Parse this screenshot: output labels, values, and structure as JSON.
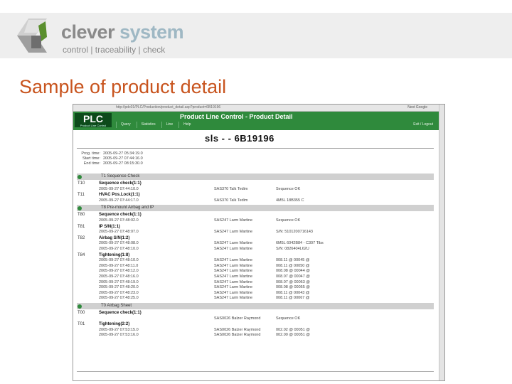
{
  "brand": {
    "name_a": "clever",
    "name_b": "system",
    "tagline": "control | traceability | check"
  },
  "slide_title": "Sample of product detail",
  "browser": {
    "url": "http://pdc01/PLC/Production/product_detail.asp?product=6B19196",
    "toolbar_right": "Next  Google"
  },
  "app": {
    "logo": "PLC",
    "logo_sub": "Product Line Control",
    "title": "Product Line Control - Product Detail",
    "nav": [
      "Query",
      "Statistics",
      "Line",
      "Help"
    ],
    "nav_right": "Exit / Logout",
    "heading": "sls -  - 6B19196"
  },
  "times": [
    {
      "label": "Prog. time:",
      "value": "2005-09-27 05:34:19.0"
    },
    {
      "label": "Start time:",
      "value": "2005-09-27 07:44:16.0"
    },
    {
      "label": "End time:",
      "value": "2005-09-27 08:15:30.0"
    }
  ],
  "sections": [
    {
      "title": "T1 Sequence Check",
      "tests": [
        {
          "code": "T10",
          "name": "Sequence check(1:1)",
          "rows": [
            {
              "date": "2005-09-27 07:44:10.0",
              "who": "SAS370 Talk Tedim",
              "result": "Sequence OK"
            }
          ]
        },
        {
          "code": "T11",
          "name": "HVAC Pos.Lock(1:1)",
          "rows": [
            {
              "date": "2005-09-27 07:44:17.0",
              "who": "SAS370 Talk Tedim",
              "result": "4M5L 18B355 C"
            }
          ]
        }
      ]
    },
    {
      "title": "T8 Pre-mount Airbag and IP",
      "tests": [
        {
          "code": "T80",
          "name": "Sequence check(1:1)",
          "rows": [
            {
              "date": "2005-09-27 07:48:02.0",
              "who": "SAS247 Larm Martine",
              "result": "Sequence OK"
            }
          ]
        },
        {
          "code": "T81",
          "name": "IP S/N(1:1)",
          "rows": [
            {
              "date": "2005-09-27 07:48:07.0",
              "who": "SAS247 Larm Martine",
              "result": "S/N: 5101200716143"
            }
          ]
        },
        {
          "code": "T82",
          "name": "Airbag S/N(1:2)",
          "rows": [
            {
              "date": "2005-09-27 07:48:08.0",
              "who": "SAS247 Larm Martine",
              "result": "6M5L 6042B84 - C307 Tibs"
            },
            {
              "date": "2005-09-27 07:48:10.0",
              "who": "SAS247 Larm Martine",
              "result": "S/N: 0826404L62U"
            }
          ]
        },
        {
          "code": "T84",
          "name": "Tightening(1:8)",
          "rows": [
            {
              "date": "2005-09-27 07:48:10.0",
              "who": "SAS247 Larm Martine",
              "result": "008.11 @ 00045 @"
            },
            {
              "date": "2005-09-27 07:48:11.0",
              "who": "SAS247 Larm Martine",
              "result": "008.11 @ 00050 @"
            },
            {
              "date": "2005-09-27 07:48:12.0",
              "who": "SAS247 Larm Martine",
              "result": "008.08 @ 00044 @"
            },
            {
              "date": "2005-09-27 07:48:16.0",
              "who": "SAS247 Larm Martine",
              "result": "008.07 @ 00047 @"
            },
            {
              "date": "2005-09-27 07:48:19.0",
              "who": "SAS247 Larm Martine",
              "result": "008.07 @ 00063 @"
            },
            {
              "date": "2005-09-27 07:48:20.0",
              "who": "SAS247 Larm Martine",
              "result": "008.08 @ 00055 @"
            },
            {
              "date": "2005-09-27 07:48:23.0",
              "who": "SAS247 Larm Martine",
              "result": "008.11 @ 00043 @"
            },
            {
              "date": "2005-09-27 07:48:25.0",
              "who": "SAS247 Larm Martine",
              "result": "008.11 @ 00067 @"
            }
          ]
        }
      ]
    },
    {
      "title": "T0 Airbag Sheet",
      "tests": [
        {
          "code": "T00",
          "name": "Sequence check(1:1)",
          "rows": [
            {
              "date": "",
              "who": "SAS0026 Balzer Raymond",
              "result": "Sequence OK"
            }
          ]
        },
        {
          "code": "T01",
          "name": "Tightening(2:2)",
          "rows": [
            {
              "date": "2005-09-27 07:53:15.0",
              "who": "SAS0026 Balzer Raymond",
              "result": "002.02 @ 00051 @"
            },
            {
              "date": "2005-09-27 07:53:16.0",
              "who": "SAS0026 Balzer Raymond",
              "result": "002.00 @ 00051 @"
            }
          ]
        }
      ]
    }
  ]
}
